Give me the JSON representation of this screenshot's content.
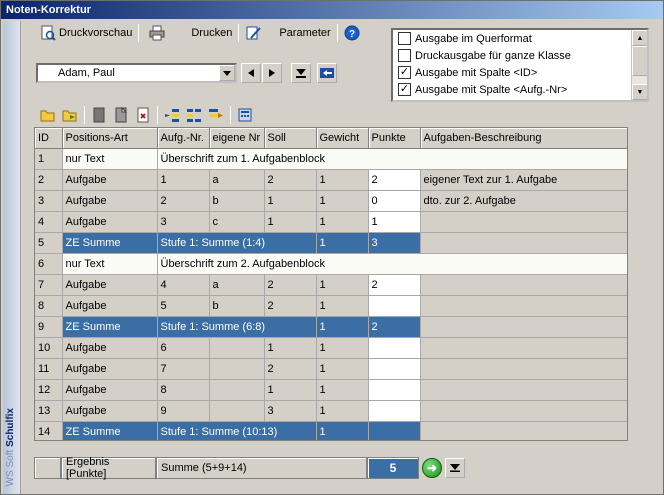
{
  "window": {
    "title": "Noten-Korrektur"
  },
  "brand": {
    "part1": "WS",
    "part2": "Soft",
    "part3": "Schulfix"
  },
  "toolbar": {
    "print_preview": "Druckvorschau",
    "print": "Drucken",
    "parameters": "Parameter"
  },
  "student": {
    "selected": "Adam, Paul"
  },
  "options": [
    {
      "label": "Ausgabe im Querformat",
      "checked": false
    },
    {
      "label": "Druckausgabe für ganze Klasse",
      "checked": false
    },
    {
      "label": "Ausgabe mit Spalte <ID>",
      "checked": true
    },
    {
      "label": "Ausgabe mit Spalte <Aufg.-Nr>",
      "checked": true
    }
  ],
  "table": {
    "headers": [
      "ID",
      "Positions-Art",
      "Aufg.-Nr.",
      "eigene Nr",
      "Soll",
      "Gewicht",
      "Punkte",
      "Aufgaben-Beschreibung"
    ],
    "rows": [
      {
        "kind": "text",
        "id": "1",
        "art": "nur Text",
        "text": "Überschrift zum 1. Aufgabenblock"
      },
      {
        "kind": "task",
        "id": "2",
        "art": "Aufgabe",
        "nr": "1",
        "own": "a",
        "soll": "2",
        "gew": "1",
        "pkt": "2",
        "desc": "eigener Text zur 1. Aufgabe"
      },
      {
        "kind": "task",
        "id": "3",
        "art": "Aufgabe",
        "nr": "2",
        "own": "b",
        "soll": "1",
        "gew": "1",
        "pkt": "0",
        "desc": "dto. zur 2. Aufgabe"
      },
      {
        "kind": "task",
        "id": "4",
        "art": "Aufgabe",
        "nr": "3",
        "own": "c",
        "soll": "1",
        "gew": "1",
        "pkt": "1",
        "desc": ""
      },
      {
        "kind": "sum",
        "id": "5",
        "art": "ZE Summe",
        "text": "Stufe 1: Summe (1:4)",
        "gew": "1",
        "pkt": "3"
      },
      {
        "kind": "text",
        "id": "6",
        "art": "nur Text",
        "text": "Überschrift zum 2. Aufgabenblock"
      },
      {
        "kind": "task",
        "id": "7",
        "art": "Aufgabe",
        "nr": "4",
        "own": "a",
        "soll": "2",
        "gew": "1",
        "pkt": "2",
        "desc": ""
      },
      {
        "kind": "task",
        "id": "8",
        "art": "Aufgabe",
        "nr": "5",
        "own": "b",
        "soll": "2",
        "gew": "1",
        "pkt": "",
        "desc": ""
      },
      {
        "kind": "sum",
        "id": "9",
        "art": "ZE Summe",
        "text": "Stufe 1: Summe (6:8)",
        "gew": "1",
        "pkt": "2"
      },
      {
        "kind": "task",
        "id": "10",
        "art": "Aufgabe",
        "nr": "6",
        "own": "",
        "soll": "1",
        "gew": "1",
        "pkt": "",
        "desc": ""
      },
      {
        "kind": "task",
        "id": "11",
        "art": "Aufgabe",
        "nr": "7",
        "own": "",
        "soll": "2",
        "gew": "1",
        "pkt": "",
        "desc": ""
      },
      {
        "kind": "task",
        "id": "12",
        "art": "Aufgabe",
        "nr": "8",
        "own": "",
        "soll": "1",
        "gew": "1",
        "pkt": "",
        "desc": ""
      },
      {
        "kind": "task",
        "id": "13",
        "art": "Aufgabe",
        "nr": "9",
        "own": "",
        "soll": "3",
        "gew": "1",
        "pkt": "",
        "desc": ""
      },
      {
        "kind": "sum",
        "id": "14",
        "art": "ZE Summe",
        "text": "Stufe 1: Summe (10:13)",
        "gew": "1",
        "pkt": ""
      }
    ]
  },
  "result": {
    "label": "Ergebnis [Punkte]",
    "formula": "Summe (5+9+14)",
    "value": "5"
  }
}
